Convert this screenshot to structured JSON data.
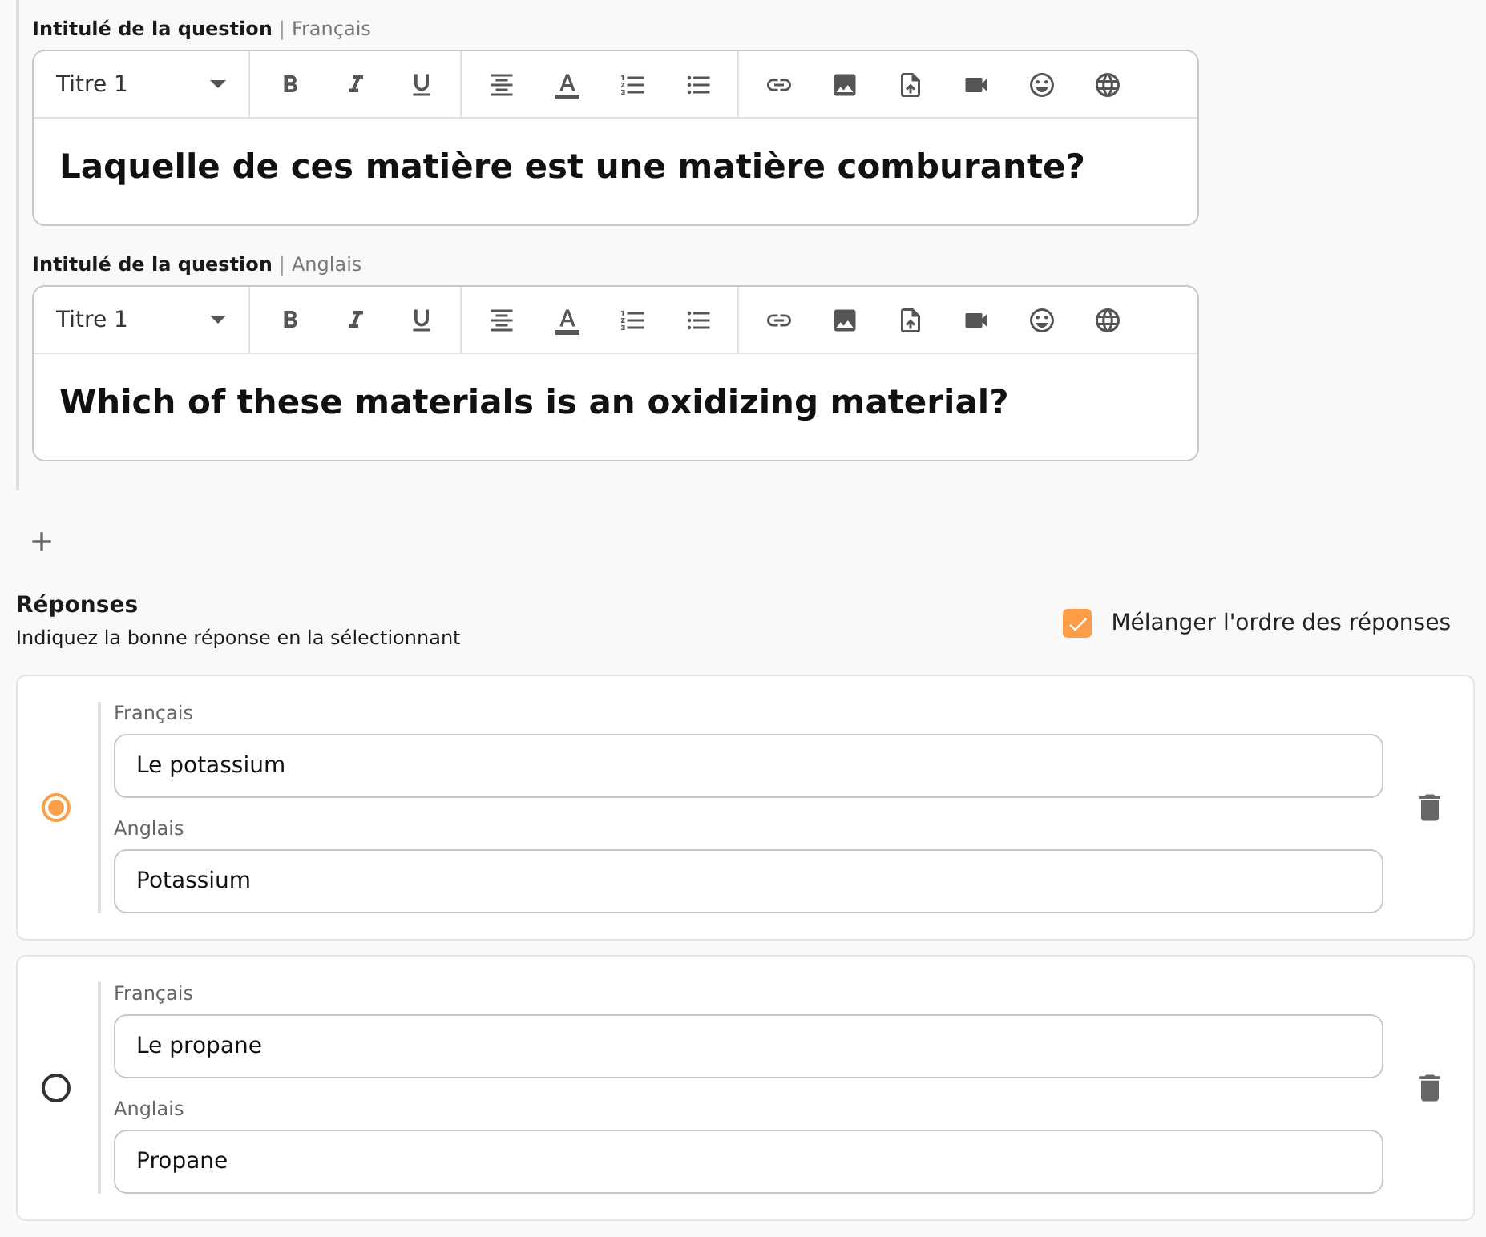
{
  "questions": [
    {
      "label": "Intitulé de la question",
      "separator": "|",
      "language": "Français",
      "style": "Titre 1",
      "text": "Laquelle de ces matière est une matière comburante?"
    },
    {
      "label": "Intitulé de la question",
      "separator": "|",
      "language": "Anglais",
      "style": "Titre 1",
      "text": "Which of these materials is an oxidizing material?"
    }
  ],
  "answers_section": {
    "title": "Réponses",
    "subtitle": "Indiquez la bonne réponse en la sélectionnant",
    "shuffle": {
      "label": "Mélanger l'ordre des réponses",
      "checked": true
    }
  },
  "answers": [
    {
      "selected": true,
      "fields": [
        {
          "label": "Français",
          "value": "Le potassium"
        },
        {
          "label": "Anglais",
          "value": "Potassium"
        }
      ]
    },
    {
      "selected": false,
      "fields": [
        {
          "label": "Français",
          "value": "Le propane"
        },
        {
          "label": "Anglais",
          "value": "Propane"
        }
      ]
    }
  ]
}
